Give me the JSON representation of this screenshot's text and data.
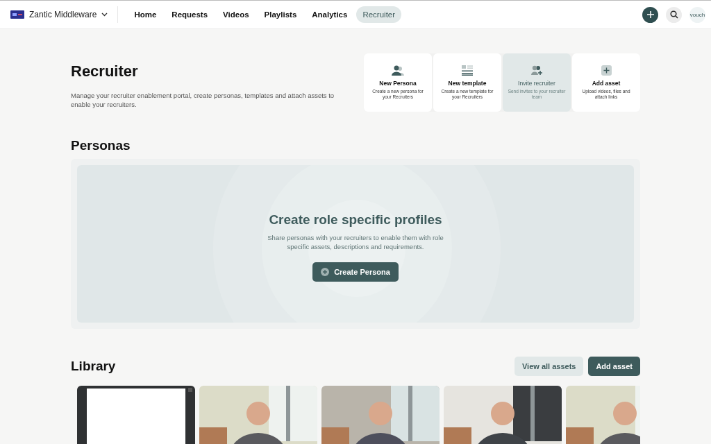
{
  "nav": {
    "org": "Zantic Middleware",
    "items": [
      {
        "label": "Home",
        "selected": false
      },
      {
        "label": "Requests",
        "selected": false
      },
      {
        "label": "Videos",
        "selected": false
      },
      {
        "label": "Playlists",
        "selected": false
      },
      {
        "label": "Analytics",
        "selected": false
      },
      {
        "label": "Recruiter",
        "selected": true
      }
    ],
    "avatar": "vouch"
  },
  "header": {
    "title": "Recruiter",
    "description": "Manage your recruiter enablement portal, create personas, templates and attach assets to enable your recruiters."
  },
  "quick_actions": [
    {
      "title": "New Persona",
      "description": "Create a new persona for your Recruiters",
      "selected": false
    },
    {
      "title": "New template",
      "description": "Create a new template for your Recruiters",
      "selected": false
    },
    {
      "title": "Invite recruiter",
      "description": "Send invites to your recruiter team",
      "selected": true
    },
    {
      "title": "Add asset",
      "description": "Upload videos, files and attach links",
      "selected": false
    }
  ],
  "personas": {
    "heading": "Personas",
    "empty_title": "Create role specific profiles",
    "empty_text": "Share personas with your recruiters to enable them with role specific assets, descriptions and requirements.",
    "button": "Create Persona"
  },
  "library": {
    "heading": "Library",
    "buttons": [
      "View all assets",
      "Add asset"
    ]
  }
}
